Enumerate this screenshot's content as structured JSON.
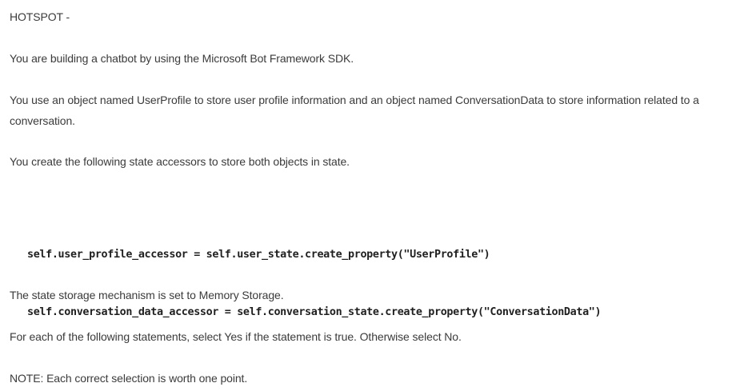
{
  "heading": "HOTSPOT -",
  "paragraphs": {
    "intro": "You are building a chatbot by using the Microsoft Bot Framework SDK.",
    "objects": "You use an object named UserProfile to store user profile information and an object named ConversationData to store information related to a conversation.",
    "accessors": "You create the following state accessors to store both objects in state.",
    "storage": "The state storage mechanism is set to Memory Storage.",
    "instructions": "For each of the following statements, select Yes if the statement is true. Otherwise select No.",
    "note": "NOTE: Each correct selection is worth one point."
  },
  "code": {
    "line1": "self.user_profile_accessor = self.user_state.create_property(\"UserProfile\")",
    "line2": "self.conversation_data_accessor = self.conversation_state.create_property(\"ConversationData\")"
  }
}
